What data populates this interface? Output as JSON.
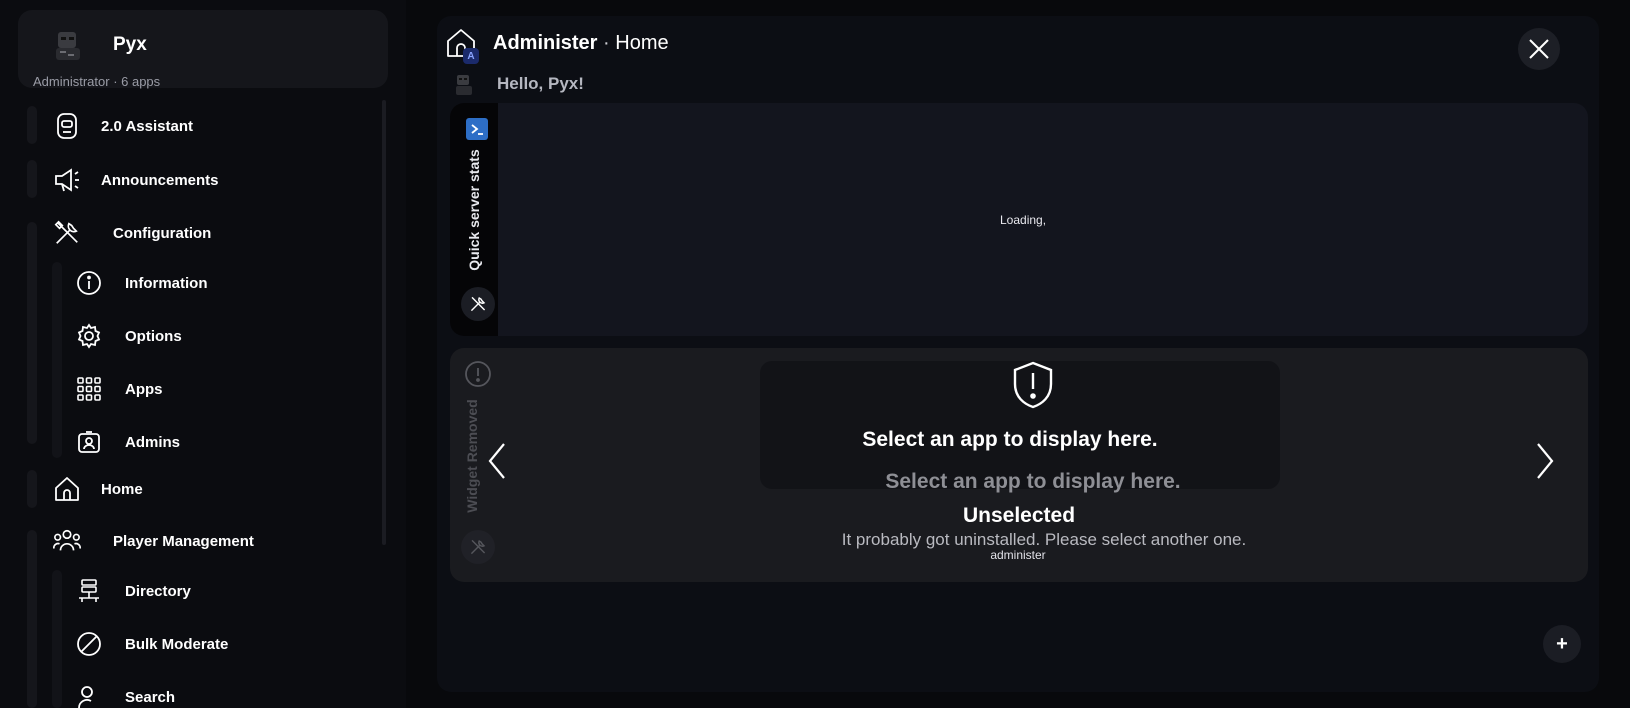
{
  "profile": {
    "name": "Pyx",
    "subtitle": "Administrator · 6 apps"
  },
  "sidebar": {
    "items": [
      {
        "label": "2.0 Assistant",
        "icon": "assistant-icon"
      },
      {
        "label": "Announcements",
        "icon": "megaphone-icon"
      },
      {
        "label": "Configuration",
        "icon": "tools-icon"
      },
      {
        "label": "Information",
        "icon": "info-icon"
      },
      {
        "label": "Options",
        "icon": "gear-icon"
      },
      {
        "label": "Apps",
        "icon": "grid-icon"
      },
      {
        "label": "Admins",
        "icon": "badge-icon"
      },
      {
        "label": "Home",
        "icon": "home-icon"
      },
      {
        "label": "Player Management",
        "icon": "users-icon"
      },
      {
        "label": "Directory",
        "icon": "directory-icon"
      },
      {
        "label": "Bulk Moderate",
        "icon": "ban-icon"
      },
      {
        "label": "Search",
        "icon": "user-search-icon"
      }
    ]
  },
  "header": {
    "app": "Administer",
    "separator": " · ",
    "page": "Home",
    "badge": "A",
    "greeting": "Hello, Pyx!"
  },
  "widgets": {
    "server_stats": {
      "label": "Quick server stats",
      "status": "Loading,"
    },
    "removed": {
      "label": "Widget Removed",
      "prompt": "Select an app to display here.",
      "title": "Unselected",
      "description": "It probably got uninstalled. Please select another one.",
      "id": "administer"
    }
  },
  "add_button": "+",
  "colors": {
    "background": "#08090c",
    "panel": "#0c0e14",
    "accent": "#2d6ec6"
  }
}
